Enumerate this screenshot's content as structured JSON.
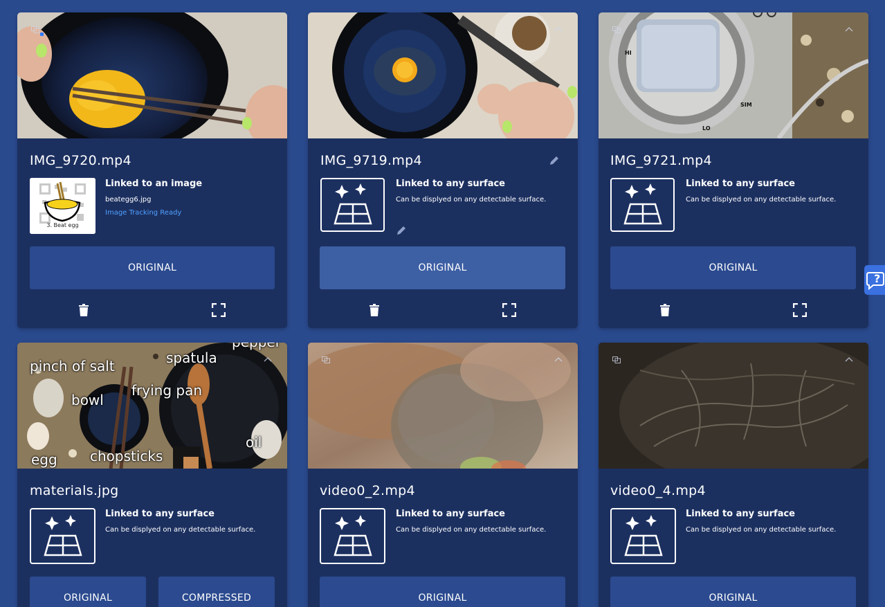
{
  "cards": [
    {
      "title": "IMG_9720.mp4",
      "link_title": "Linked to an image",
      "link_sub": "beategg6.jpg",
      "link_status": "Image Tracking Ready",
      "marker_caption": "3. Beat egg",
      "buttons": [
        "ORIGINAL"
      ]
    },
    {
      "title": "IMG_9719.mp4",
      "link_title": "Linked to any surface",
      "link_sub": "Can be displyed on any detectable surface.",
      "buttons": [
        "ORIGINAL"
      ]
    },
    {
      "title": "IMG_9721.mp4",
      "link_title": "Linked to any surface",
      "link_sub": "Can be displyed on any detectable surface.",
      "thumb_labels": [
        "HI",
        "SIM",
        "LO"
      ],
      "buttons": [
        "ORIGINAL"
      ]
    },
    {
      "title": "materials.jpg",
      "link_title": "Linked to any surface",
      "link_sub": "Can be displyed on any detectable surface.",
      "thumb_labels": [
        "pinch of salt",
        "spatula",
        "pepper",
        "bowl",
        "frying pan",
        "oil",
        "egg",
        "chopsticks"
      ],
      "buttons": [
        "ORIGINAL",
        "COMPRESSED"
      ]
    },
    {
      "title": "video0_2.mp4",
      "link_title": "Linked to any surface",
      "link_sub": "Can be displyed on any detectable surface.",
      "buttons": [
        "ORIGINAL"
      ]
    },
    {
      "title": "video0_4.mp4",
      "link_title": "Linked to any surface",
      "link_sub": "Can be displyed on any detectable surface.",
      "buttons": [
        "ORIGINAL"
      ]
    }
  ],
  "help_label": "?",
  "colors": {
    "page_bg": "#2a4a8e",
    "card_bg": "#1c3060",
    "button_bg": "#2b4a8f",
    "button_hover_bg": "#3d5fa4",
    "status_blue": "#4fa0ff",
    "help_bg": "#3a70e0"
  },
  "icons": {
    "surface": "ar-surface-icon",
    "delete": "trash-icon",
    "fullscreen": "fullscreen-icon",
    "edit": "pencil-icon",
    "copy": "copy-icon",
    "collapse": "chevron-up-icon",
    "help": "help-chat-icon"
  }
}
